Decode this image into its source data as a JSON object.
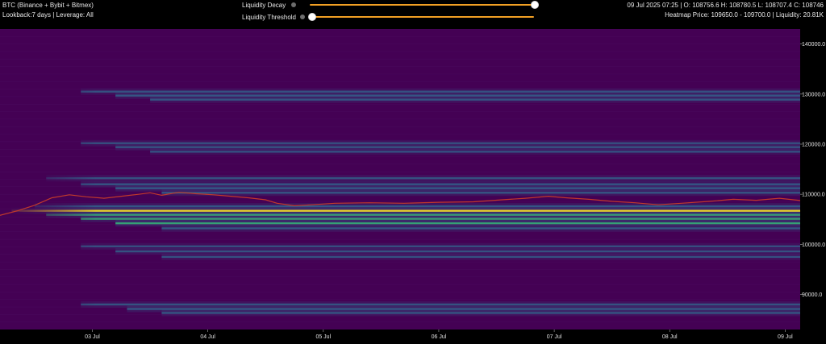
{
  "header": {
    "title": "BTC (Binance + Bybit + Bitmex)",
    "subtitle": "Lookback:7 days | Leverage: All",
    "ohlc": "09 Jul 2025 07:25 | O: 108756.6 H: 108780.5 L: 108707.4 C: 108746",
    "heatmap_info": "Heatmap Price: 109650.0 - 109700.0 | Liquidity: 20.81K"
  },
  "controls": {
    "decay": {
      "label": "Liquidity Decay",
      "value": 1.0
    },
    "threshold": {
      "label": "Liquidity Threshold",
      "value": 0.0
    }
  },
  "colors": {
    "background": "#000000",
    "heatmap_base": "#440154",
    "band_mid": "#31688e",
    "band_strong": "#35b779",
    "band_peak": "#fde725",
    "price_line": "#c0392b",
    "slider_track": "#f2a024"
  },
  "chart_data": {
    "type": "heatmap",
    "ylim": [
      83000,
      143000
    ],
    "y_ticks": [
      {
        "value": 140000,
        "label": "140000.0"
      },
      {
        "value": 130000,
        "label": "130000.0"
      },
      {
        "value": 120000,
        "label": "120000.0"
      },
      {
        "value": 110000,
        "label": "110000.0"
      },
      {
        "value": 100000,
        "label": "100000.0"
      },
      {
        "value": 90000,
        "label": "90000.0"
      }
    ],
    "x_ticks": [
      {
        "day": 1,
        "label": "03 Jul"
      },
      {
        "day": 2,
        "label": "04 Jul"
      },
      {
        "day": 3,
        "label": "05 Jul"
      },
      {
        "day": 4,
        "label": "06 Jul"
      },
      {
        "day": 5,
        "label": "07 Jul"
      },
      {
        "day": 6,
        "label": "08 Jul"
      },
      {
        "day": 7,
        "label": "09 Jul"
      }
    ],
    "xlim": [
      0.2,
      7.13
    ],
    "bands": [
      {
        "price": 130500,
        "start": 0.9,
        "intensity": 0.45
      },
      {
        "price": 129700,
        "start": 1.2,
        "intensity": 0.55
      },
      {
        "price": 128900,
        "start": 1.5,
        "intensity": 0.5
      },
      {
        "price": 120200,
        "start": 0.9,
        "intensity": 0.4
      },
      {
        "price": 119400,
        "start": 1.2,
        "intensity": 0.5
      },
      {
        "price": 118500,
        "start": 1.5,
        "intensity": 0.45
      },
      {
        "price": 113200,
        "start": 0.6,
        "intensity": 0.5
      },
      {
        "price": 112000,
        "start": 0.9,
        "intensity": 0.55
      },
      {
        "price": 111200,
        "start": 1.2,
        "intensity": 0.6
      },
      {
        "price": 110300,
        "start": 1.6,
        "intensity": 0.55
      },
      {
        "price": 107600,
        "start": 0.5,
        "intensity": 0.6
      },
      {
        "price": 106700,
        "start": 0.3,
        "intensity": 0.85
      },
      {
        "price": 105900,
        "start": 0.6,
        "intensity": 0.7
      },
      {
        "price": 105100,
        "start": 0.9,
        "intensity": 0.65
      },
      {
        "price": 104200,
        "start": 1.2,
        "intensity": 0.75
      },
      {
        "price": 103200,
        "start": 1.6,
        "intensity": 0.55
      },
      {
        "price": 99600,
        "start": 0.9,
        "intensity": 0.45
      },
      {
        "price": 98600,
        "start": 1.2,
        "intensity": 0.5
      },
      {
        "price": 97500,
        "start": 1.6,
        "intensity": 0.45
      },
      {
        "price": 88000,
        "start": 0.9,
        "intensity": 0.5
      },
      {
        "price": 87100,
        "start": 1.3,
        "intensity": 0.6
      },
      {
        "price": 86300,
        "start": 1.6,
        "intensity": 0.5
      }
    ],
    "price_series": [
      {
        "day": 0.2,
        "price": 105800
      },
      {
        "day": 0.35,
        "price": 106700
      },
      {
        "day": 0.5,
        "price": 107800
      },
      {
        "day": 0.65,
        "price": 109300
      },
      {
        "day": 0.8,
        "price": 109900
      },
      {
        "day": 0.95,
        "price": 109500
      },
      {
        "day": 1.1,
        "price": 109200
      },
      {
        "day": 1.25,
        "price": 109600
      },
      {
        "day": 1.4,
        "price": 110000
      },
      {
        "day": 1.5,
        "price": 110300
      },
      {
        "day": 1.6,
        "price": 109800
      },
      {
        "day": 1.75,
        "price": 110400
      },
      {
        "day": 1.9,
        "price": 110100
      },
      {
        "day": 2.05,
        "price": 109900
      },
      {
        "day": 2.2,
        "price": 109600
      },
      {
        "day": 2.35,
        "price": 109300
      },
      {
        "day": 2.5,
        "price": 108900
      },
      {
        "day": 2.6,
        "price": 108200
      },
      {
        "day": 2.75,
        "price": 107700
      },
      {
        "day": 2.9,
        "price": 107900
      },
      {
        "day": 3.1,
        "price": 108200
      },
      {
        "day": 3.4,
        "price": 108300
      },
      {
        "day": 3.7,
        "price": 108200
      },
      {
        "day": 4.0,
        "price": 108400
      },
      {
        "day": 4.3,
        "price": 108500
      },
      {
        "day": 4.55,
        "price": 108900
      },
      {
        "day": 4.75,
        "price": 109200
      },
      {
        "day": 4.95,
        "price": 109600
      },
      {
        "day": 5.1,
        "price": 109300
      },
      {
        "day": 5.3,
        "price": 109000
      },
      {
        "day": 5.5,
        "price": 108600
      },
      {
        "day": 5.7,
        "price": 108300
      },
      {
        "day": 5.9,
        "price": 107900
      },
      {
        "day": 6.1,
        "price": 108200
      },
      {
        "day": 6.35,
        "price": 108600
      },
      {
        "day": 6.55,
        "price": 109000
      },
      {
        "day": 6.75,
        "price": 108800
      },
      {
        "day": 6.95,
        "price": 109200
      },
      {
        "day": 7.13,
        "price": 108746
      }
    ]
  }
}
